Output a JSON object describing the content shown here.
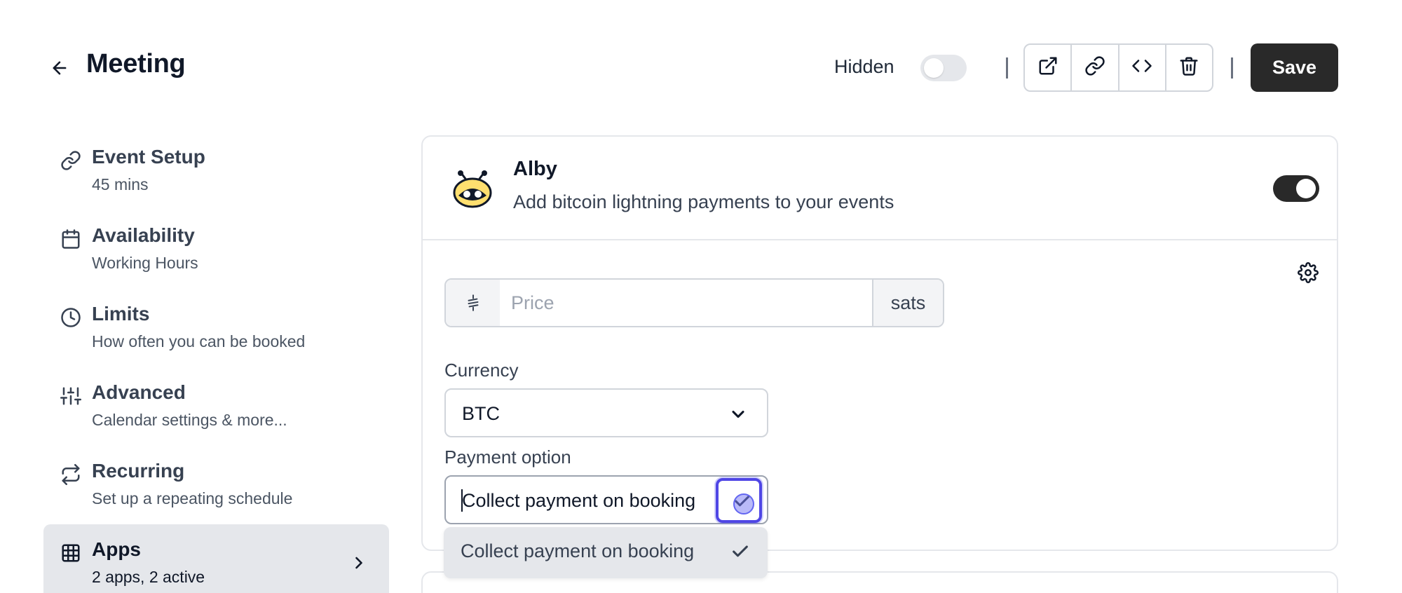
{
  "header": {
    "title": "Meeting",
    "hidden_label": "Hidden",
    "hidden_toggle_on": false,
    "save_label": "Save",
    "actions": [
      "external-link-icon",
      "link-icon",
      "code-icon",
      "trash-icon"
    ]
  },
  "sidebar": {
    "items": [
      {
        "title": "Event Setup",
        "subtitle": "45 mins",
        "icon": "link-icon"
      },
      {
        "title": "Availability",
        "subtitle": "Working Hours",
        "icon": "calendar-icon"
      },
      {
        "title": "Limits",
        "subtitle": "How often you can be booked",
        "icon": "clock-icon"
      },
      {
        "title": "Advanced",
        "subtitle": "Calendar settings & more...",
        "icon": "sliders-icon"
      },
      {
        "title": "Recurring",
        "subtitle": "Set up a repeating schedule",
        "icon": "repeat-icon"
      },
      {
        "title": "Apps",
        "subtitle": "2 apps, 2 active",
        "icon": "grid-icon",
        "active": true
      }
    ]
  },
  "app": {
    "name": "Alby",
    "description": "Add bitcoin lightning payments to your events",
    "enabled": true,
    "price": {
      "placeholder": "Price",
      "value": "",
      "suffix": "sats"
    },
    "currency": {
      "label": "Currency",
      "value": "BTC"
    },
    "payment_option": {
      "label": "Payment option",
      "value": "Collect payment on booking",
      "options": [
        "Collect payment on booking"
      ]
    }
  },
  "colors": {
    "primary": "#292929",
    "focus": "#4f46e5",
    "border": "#d1d5db",
    "active_bg": "#e5e7eb"
  }
}
